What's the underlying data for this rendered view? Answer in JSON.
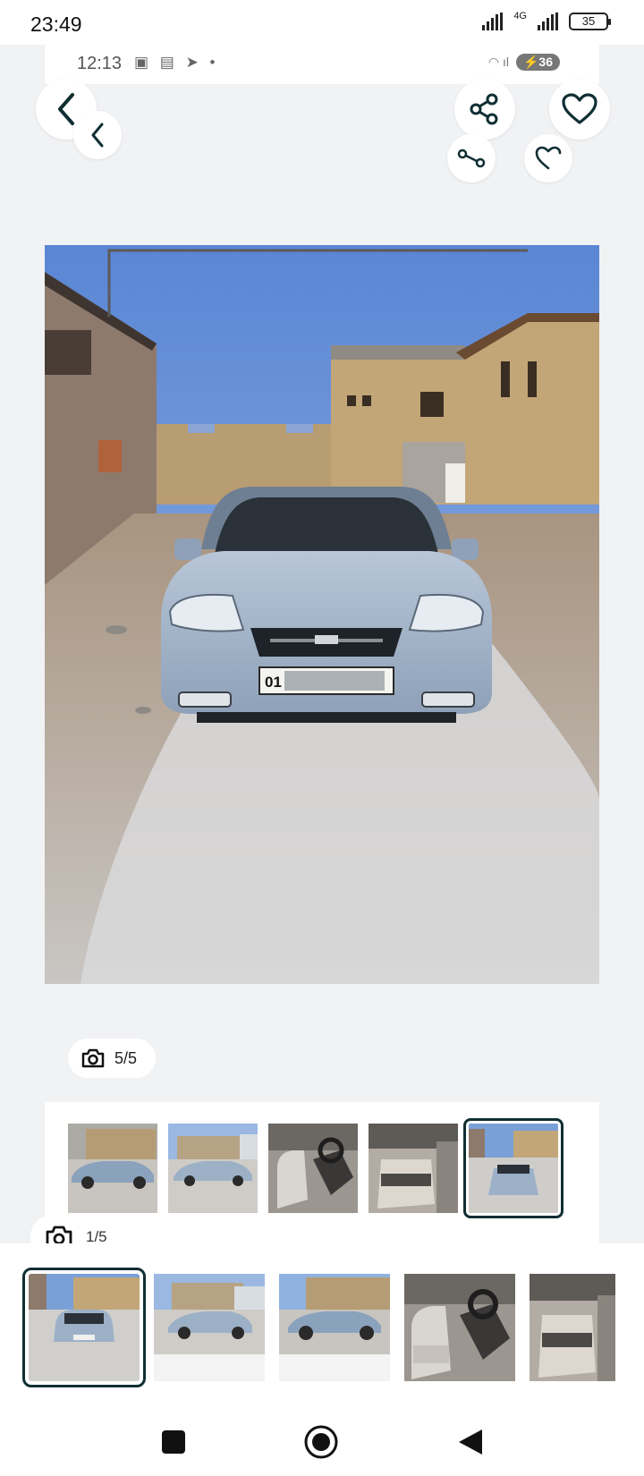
{
  "outer_status": {
    "time": "23:49",
    "network": "4G",
    "battery": "35"
  },
  "inner_status": {
    "time": "12:13",
    "badge": "36"
  },
  "main_counter": "5/5",
  "strip_counter": "1/5",
  "plate_text": "01",
  "colors": {
    "accent": "#0f2f33",
    "background": "#f1f2f4"
  },
  "icons": [
    "back-icon",
    "share-icon",
    "heart-icon",
    "camera-icon"
  ],
  "thumbnails": [
    "car-side-1",
    "car-side-2",
    "interior-front",
    "interior-rear",
    "car-front"
  ],
  "bottom_thumbnails": [
    "car-front",
    "car-side-2",
    "car-side-1",
    "interior-front",
    "interior-rear"
  ]
}
